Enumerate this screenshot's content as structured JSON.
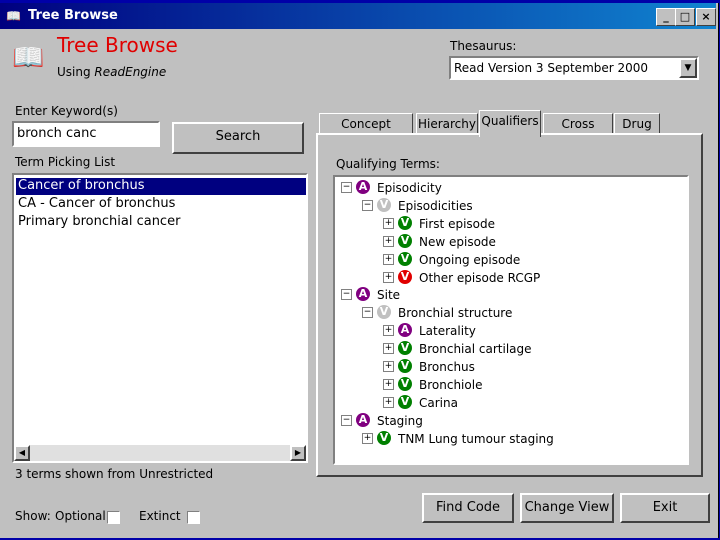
{
  "window": {
    "title": "Tree Browse"
  },
  "header": {
    "app_name": "Tree Browse",
    "using_label": "Using",
    "engine": "ReadEngine",
    "thesaurus_label": "Thesaurus:",
    "thesaurus_value": "Read Version 3 September 2000"
  },
  "search": {
    "keyword_label": "Enter Keyword(s)",
    "keyword_value": "bronch canc",
    "search_button": "Search"
  },
  "picklist": {
    "label": "Term Picking List",
    "items": [
      "Cancer of bronchus",
      "CA - Cancer of bronchus",
      "Primary bronchial cancer"
    ],
    "status": "3 terms shown from Unrestricted"
  },
  "show": {
    "label": "Show:",
    "optional": "Optional",
    "extinct": "Extinct"
  },
  "tabs": [
    "Concept Details",
    "Hierarchy",
    "Qualifiers",
    "Cross Maps",
    "Drug"
  ],
  "qualifiers": {
    "label": "Qualifying Terms:",
    "tree": [
      {
        "badge": "A",
        "text": "Episodicity",
        "color": "#800080"
      },
      {
        "badge": "V",
        "text": "Episodicities",
        "color": "#c0c0c0"
      },
      {
        "badge": "V",
        "text": "First episode",
        "color": "#008000"
      },
      {
        "badge": "V",
        "text": "New episode",
        "color": "#008000"
      },
      {
        "badge": "V",
        "text": "Ongoing episode",
        "color": "#008000"
      },
      {
        "badge": "V",
        "text": "Other episode RCGP",
        "color": "#e00000"
      },
      {
        "badge": "A",
        "text": "Site",
        "color": "#800080"
      },
      {
        "badge": "V",
        "text": "Bronchial structure",
        "color": "#c0c0c0"
      },
      {
        "badge": "A",
        "text": "Laterality",
        "color": "#800080"
      },
      {
        "badge": "V",
        "text": "Bronchial cartilage",
        "color": "#008000"
      },
      {
        "badge": "V",
        "text": "Bronchus",
        "color": "#008000"
      },
      {
        "badge": "V",
        "text": "Bronchiole",
        "color": "#008000"
      },
      {
        "badge": "V",
        "text": "Carina",
        "color": "#008000"
      },
      {
        "badge": "A",
        "text": "Staging",
        "color": "#800080"
      },
      {
        "badge": "V",
        "text": "TNM Lung tumour staging",
        "color": "#008000"
      }
    ]
  },
  "buttons": {
    "find_code": "Find Code",
    "change_view": "Change View",
    "exit": "Exit"
  }
}
